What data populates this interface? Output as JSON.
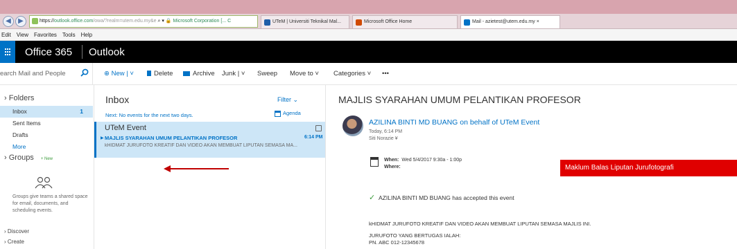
{
  "browser": {
    "address_url_prefix": "https://",
    "address_url_domain": "outlook.office.com",
    "address_url_rest": "/owa/?realm=utem.edu.my&e",
    "address_url_icons": "⌕ ▾ 🔒",
    "address_cert": "Microsoft Corporation [... C",
    "tabs": [
      {
        "label": "UTeM | Universiti Teknikal Mal...",
        "icon_color": "#1f5fa8"
      },
      {
        "label": "Microsoft Office Home",
        "icon_color": "#d04a02"
      },
      {
        "label": "Mail - azietest@utem.edu.my ×",
        "icon_color": "#0072c6"
      }
    ]
  },
  "menubar": [
    "Edit",
    "View",
    "Favorites",
    "Tools",
    "Help"
  ],
  "header": {
    "suite": "Office 365",
    "app": "Outlook"
  },
  "commandbar": {
    "search_placeholder": "earch Mail and People",
    "new": "⊕ New | ˅",
    "delete": "Delete",
    "archive": "Archive",
    "junk": "Junk | ˅",
    "sweep": "Sweep",
    "move_to": "Move to ˅",
    "categories": "Categories ˅",
    "more": "•••"
  },
  "folders": {
    "heading": "Folders",
    "items": [
      {
        "label": "Inbox",
        "count": "1"
      },
      {
        "label": "Sent Items",
        "count": ""
      },
      {
        "label": "Drafts",
        "count": ""
      }
    ],
    "more": "More",
    "groups_heading": "Groups",
    "groups_new": "+ New",
    "groups_desc": "Groups give teams a shared space for email, documents, and scheduling events.",
    "discover": "Discover",
    "create": "Create"
  },
  "message_list": {
    "title": "Inbox",
    "filter": "Filter ⌄",
    "next_events": "Next: No events for the next two days.",
    "agenda": "Agenda",
    "messages": [
      {
        "sender": "UTeM Event",
        "subject": "MAJLIS SYARAHAN UMUM PELANTIKAN PROFESOR",
        "time": "6:14 PM",
        "preview": "kHIDMAT JURUFOTO KREATIF DAN VIDEO AKAN MEMBUAT LIPUTAN SEMASA MA..."
      }
    ]
  },
  "reading_pane": {
    "subject": "MAJLIS SYARAHAN UMUM PELANTIKAN PROFESOR",
    "from": "AZILINA BINTI MD BUANG on behalf of UTeM Event",
    "sent": "Today, 6:14 PM",
    "to": "Siti Norazie ¥",
    "when_label": "When:",
    "when_value": "Wed 5/4/2017 9:30a - 1:00p",
    "where_label": "Where:",
    "accepted": "AZILINA BINTI MD BUANG has accepted this event",
    "body": [
      "kHIDMAT JURUFOTO KREATIF DAN VIDEO AKAN MEMBUAT LIPUTAN SEMASA MAJLIS INI.",
      "JURUFOTO YANG BERTUGAS IALAH:",
      "PN. ABC 012-12345678"
    ]
  },
  "annotation": {
    "callout": "Maklum Balas Liputan Jurufotografi",
    "color": "#e00000"
  }
}
